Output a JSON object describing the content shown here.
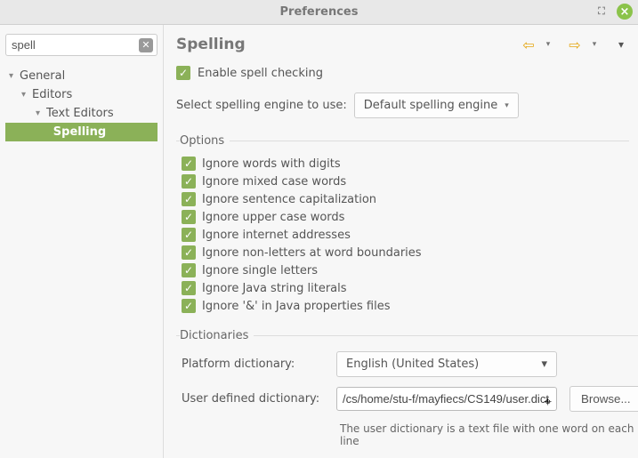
{
  "window": {
    "title": "Preferences"
  },
  "sidebar": {
    "search_value": "spell",
    "tree": {
      "general": "General",
      "editors": "Editors",
      "text_editors": "Text Editors",
      "spelling": "Spelling"
    }
  },
  "page": {
    "title": "Spelling",
    "enable_label": "Enable spell checking",
    "engine_label": "Select spelling engine to use:",
    "engine_value": "Default spelling engine",
    "options_legend": "Options",
    "options": [
      "Ignore words with digits",
      "Ignore mixed case words",
      "Ignore sentence capitalization",
      "Ignore upper case words",
      "Ignore internet addresses",
      "Ignore non-letters at word boundaries",
      "Ignore single letters",
      "Ignore Java string literals",
      "Ignore '&' in Java properties files"
    ],
    "dict_legend": "Dictionaries",
    "platform_dict_label": "Platform dictionary:",
    "platform_dict_value": "English (United States)",
    "user_dict_label": "User defined dictionary:",
    "user_dict_value": "/cs/home/stu-f/mayfiecs/CS149/user.dict",
    "browse_label": "Browse...",
    "user_dict_hint": "The user dictionary is a text file with one word on each line"
  }
}
